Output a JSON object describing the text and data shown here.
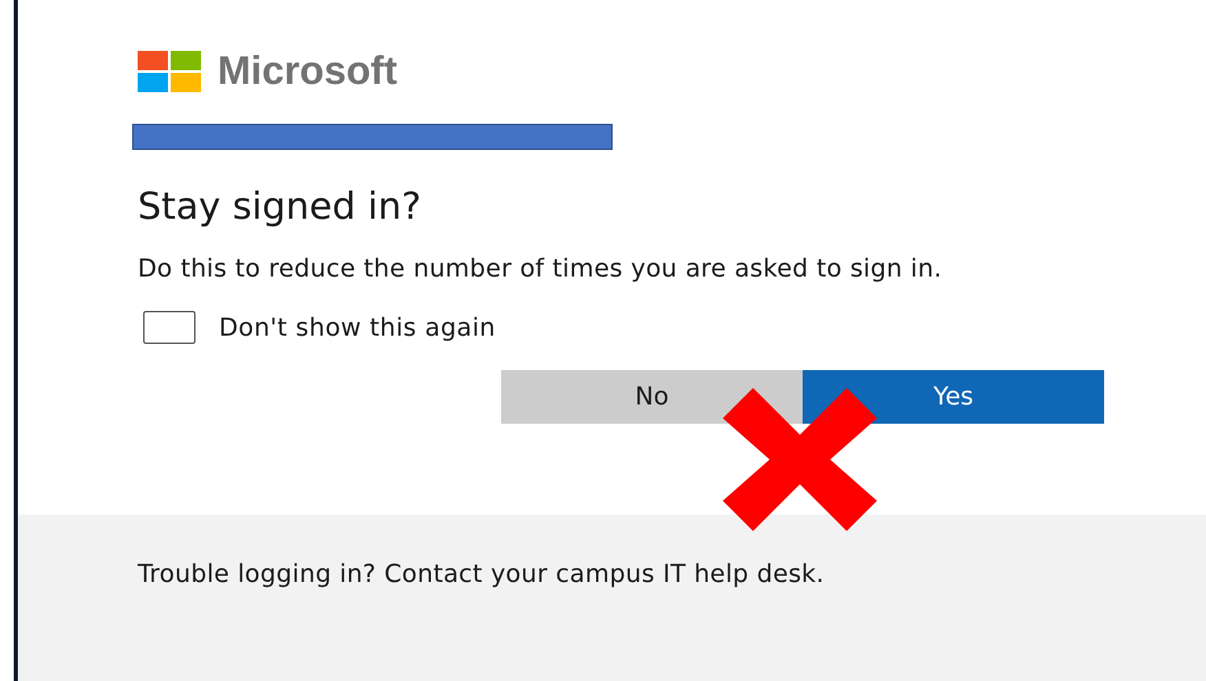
{
  "brand": "Microsoft",
  "account": {
    "redacted": true
  },
  "title": "Stay signed in?",
  "description": "Do this to reduce the number of times you are asked to sign in.",
  "checkbox": {
    "label": "Don't show this again",
    "checked": false
  },
  "buttons": [
    {
      "label": "No",
      "kind": "secondary"
    },
    {
      "label": "Yes",
      "kind": "primary"
    }
  ],
  "annotation": {
    "kind": "cross"
  },
  "footer": "Trouble logging in? Contact your campus IT help desk."
}
